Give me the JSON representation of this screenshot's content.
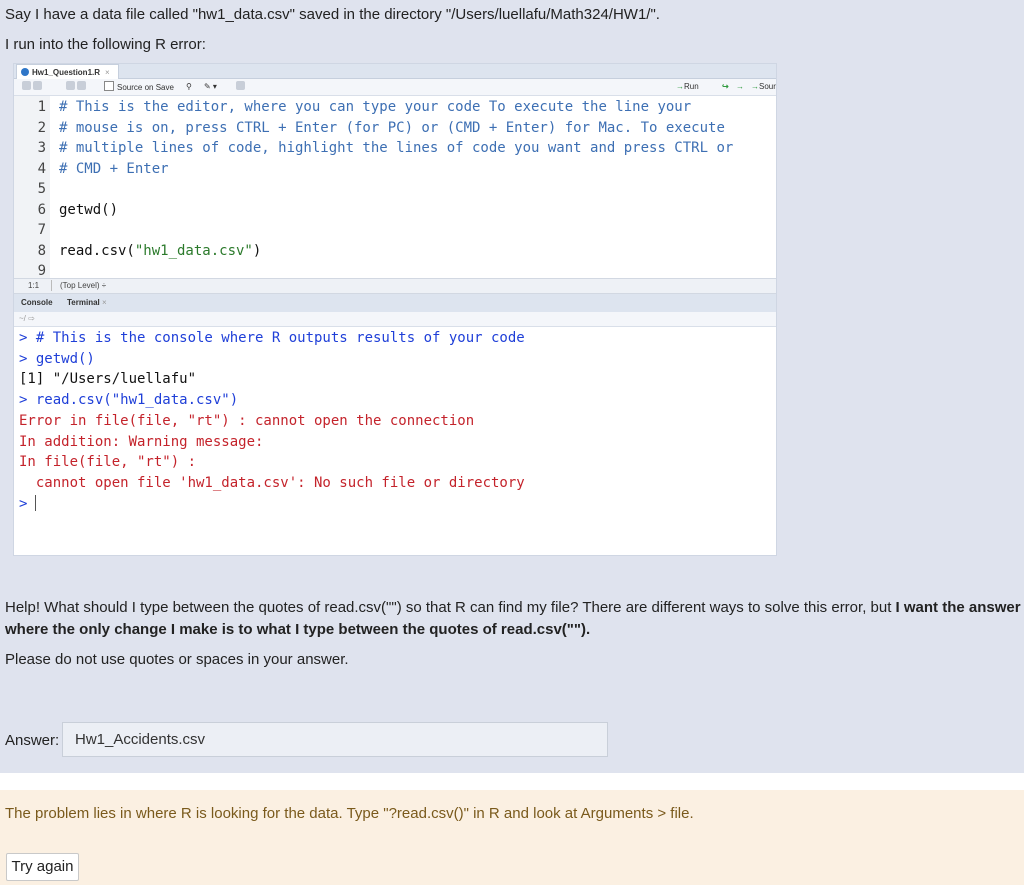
{
  "question": {
    "line1": "Say I have a data file called \"hw1_data.csv\" saved in the directory \"/Users/luellafu/Math324/HW1/\".",
    "line2": "I run into the following R error:",
    "help_line1_normal": "Help! What should I type between the quotes of read.csv(\"\") so that R can find my file? There are different ways to solve this error, but ",
    "help_line1_bold": "I want the answer",
    "help_line2_bold": "where the only change I make is to what I type between the quotes of read.csv(\"\").",
    "instructions": "Please do not use quotes or spaces in your answer."
  },
  "rstudio": {
    "tab_label": "Hw1_Question1.R",
    "tab_close": "×",
    "source_on_save": "Source on Save",
    "run_label": "Run",
    "source_label": "Sourc",
    "editor_lines": [
      {
        "n": "1",
        "text": "# This is the editor, where you can type your code To execute the line your",
        "kind": "comment"
      },
      {
        "n": "2",
        "text": "# mouse is on, press CTRL + Enter (for PC) or (CMD + Enter) for Mac. To execute",
        "kind": "comment"
      },
      {
        "n": "3",
        "text": "# multiple lines of code, highlight the lines of code you want and press CTRL or",
        "kind": "comment"
      },
      {
        "n": "4",
        "text": "# CMD + Enter",
        "kind": "comment"
      },
      {
        "n": "5",
        "text": "",
        "kind": "plain"
      },
      {
        "n": "6",
        "text": "getwd()",
        "kind": "plain"
      },
      {
        "n": "7",
        "text": "",
        "kind": "plain"
      },
      {
        "n": "8",
        "text_pre": "read.csv(",
        "text_str": "\"hw1_data.csv\"",
        "text_post": ")",
        "kind": "mixed"
      },
      {
        "n": "9",
        "text": "",
        "kind": "plain"
      }
    ],
    "cursor_pos": "1:1",
    "scope": "(Top Level) ÷",
    "console_tab": "Console",
    "terminal_tab": "Terminal",
    "terminal_close": "×",
    "console_path": "~/ ⇨",
    "console_lines": [
      {
        "text": "> # This is the console where R outputs results of your code",
        "kind": "blue"
      },
      {
        "text": "> getwd()",
        "kind": "blue"
      },
      {
        "text": "[1] \"/Users/luellafu\"",
        "kind": "black"
      },
      {
        "text": "> read.csv(\"hw1_data.csv\")",
        "kind": "blue"
      },
      {
        "text": "Error in file(file, \"rt\") : cannot open the connection",
        "kind": "red"
      },
      {
        "text": "In addition: Warning message:",
        "kind": "red"
      },
      {
        "text": "In file(file, \"rt\") :",
        "kind": "red"
      },
      {
        "text": "  cannot open file 'hw1_data.csv': No such file or directory",
        "kind": "red"
      }
    ],
    "prompt": ">"
  },
  "answer": {
    "label": "Answer:",
    "value": "Hw1_Accidents.csv"
  },
  "feedback": {
    "message": "The problem lies in where R is looking for the data. Type \"?read.csv()\" in R and look at Arguments > file.",
    "try_again": "Try again"
  }
}
